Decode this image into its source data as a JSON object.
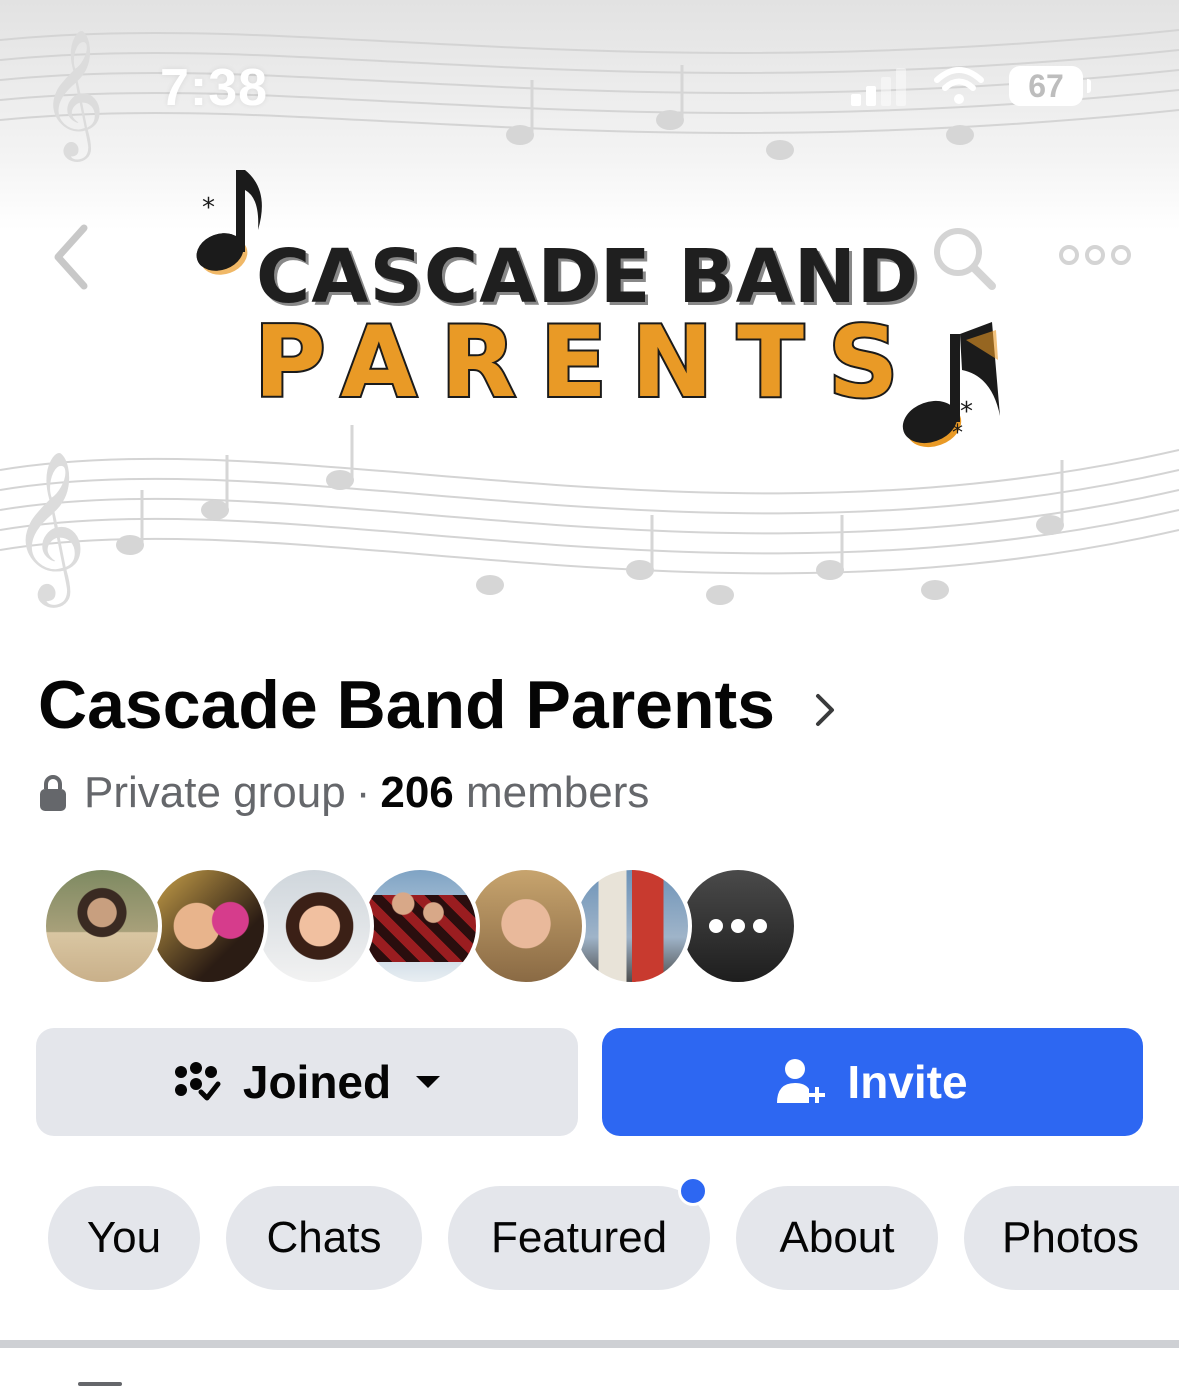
{
  "status_bar": {
    "time": "7:38",
    "battery": "67"
  },
  "cover": {
    "logo_line1": "CASCADE BAND",
    "logo_line2": "PARENTS"
  },
  "colors": {
    "accent_blue": "#2d67f2",
    "button_gray": "#e4e6eb",
    "logo_orange": "#e99a26",
    "text_secondary": "#65676b"
  },
  "group": {
    "title": "Cascade Band Parents",
    "privacy": "Private group",
    "separator": "·",
    "member_count": "206",
    "members_label": "members"
  },
  "member_avatars": [
    {
      "name": "member-avatar-1"
    },
    {
      "name": "member-avatar-2"
    },
    {
      "name": "member-avatar-3"
    },
    {
      "name": "member-avatar-4"
    },
    {
      "name": "member-avatar-5"
    },
    {
      "name": "member-avatar-6"
    },
    {
      "name": "member-avatar-more"
    }
  ],
  "actions": {
    "joined_label": "Joined",
    "invite_label": "Invite"
  },
  "tabs": [
    {
      "label": "You"
    },
    {
      "label": "Chats"
    },
    {
      "label": "Featured",
      "has_new": true
    },
    {
      "label": "About"
    },
    {
      "label": "Photos"
    }
  ]
}
